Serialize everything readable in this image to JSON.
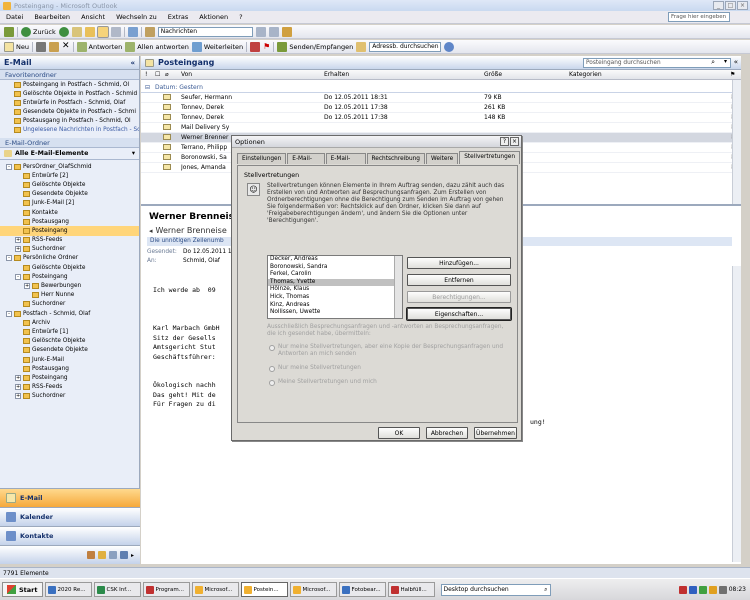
{
  "window": {
    "title": "Posteingang - Microsoft Outlook",
    "min": "_",
    "max": "□",
    "close": "×"
  },
  "menu": {
    "items": [
      "Datei",
      "Bearbeiten",
      "Ansicht",
      "Wechseln zu",
      "Extras",
      "Aktionen",
      "?"
    ],
    "help_placeholder": "Frage hier eingeben"
  },
  "toolbar1": {
    "back": "Zurück",
    "folder_combo": "Nachrichten"
  },
  "toolbar2": {
    "new": "Neu",
    "reply": "Antworten",
    "reply_all": "Allen antworten",
    "forward": "Weiterleiten",
    "send_receive": "Senden/Empfangen",
    "address_search": "Adressb. durchsuchen"
  },
  "nav": {
    "title": "E-Mail",
    "favorites_header": "Favoritenordner",
    "favorites": [
      "Posteingang in Postfach - Schmid, Ol",
      "Gelöschte Objekte in Postfach - Schmid",
      "Entwürfe in Postfach - Schmid, Olaf",
      "Gesendete Objekte in Postfach - Schmi",
      "Postausgang in Postfach - Schmid, Ol",
      "Ungelesene Nachrichten in Postfach - Sch"
    ],
    "mail_folders_header": "E-Mail-Ordner",
    "all_items": "Alle E-Mail-Elemente",
    "tree": [
      {
        "label": "PersOrdner_OlafSchmid",
        "indent": 0,
        "exp": "-"
      },
      {
        "label": "Entwürfe [2]",
        "indent": 1
      },
      {
        "label": "Gelöschte Objekte",
        "indent": 1
      },
      {
        "label": "Gesendete Objekte",
        "indent": 1
      },
      {
        "label": "Junk-E-Mail [2]",
        "indent": 1
      },
      {
        "label": "Kontakte",
        "indent": 1
      },
      {
        "label": "Postausgang",
        "indent": 1
      },
      {
        "label": "Posteingang",
        "indent": 1,
        "selected": true
      },
      {
        "label": "RSS-Feeds",
        "indent": 1,
        "exp": "+"
      },
      {
        "label": "Suchordner",
        "indent": 1,
        "exp": "+"
      },
      {
        "label": "Persönliche Ordner",
        "indent": 0,
        "exp": "-"
      },
      {
        "label": "Gelöschte Objekte",
        "indent": 1
      },
      {
        "label": "Posteingang",
        "indent": 1,
        "exp": "-"
      },
      {
        "label": "Bewerbungen",
        "indent": 2,
        "exp": "+"
      },
      {
        "label": "Herr Nunne",
        "indent": 2
      },
      {
        "label": "Suchordner",
        "indent": 1
      },
      {
        "label": "Postfach - Schmid, Olaf",
        "indent": 0,
        "exp": "-"
      },
      {
        "label": "Archiv",
        "indent": 1
      },
      {
        "label": "Entwürfe [1]",
        "indent": 1
      },
      {
        "label": "Gelöschte Objekte",
        "indent": 1
      },
      {
        "label": "Gesendete Objekte",
        "indent": 1
      },
      {
        "label": "Junk-E-Mail",
        "indent": 1
      },
      {
        "label": "Postausgang",
        "indent": 1
      },
      {
        "label": "Posteingang",
        "indent": 1,
        "exp": "+"
      },
      {
        "label": "RSS-Feeds",
        "indent": 1,
        "exp": "+"
      },
      {
        "label": "Suchordner",
        "indent": 1,
        "exp": "+"
      }
    ],
    "buttons": [
      "E-Mail",
      "Kalender",
      "Kontakte"
    ]
  },
  "list": {
    "title": "Posteingang",
    "search_placeholder": "Posteingang durchsuchen",
    "columns": {
      "from": "Von",
      "received": "Erhalten",
      "size": "Größe",
      "categories": "Kategorien"
    },
    "group": "Datum: Gestern",
    "rows": [
      {
        "from": "Seufer, Hermann",
        "date": "Do 12.05.2011 18:31",
        "size": "79 KB"
      },
      {
        "from": "Tonnev, Derek",
        "date": "Do 12.05.2011 17:38",
        "size": "261 KB"
      },
      {
        "from": "Tonnev, Derek",
        "date": "Do 12.05.2011 17:38",
        "size": "148 KB"
      },
      {
        "from": "Mail Delivery Sy",
        "date": "",
        "size": ""
      },
      {
        "from": "Werner Brenner",
        "date": "",
        "size": "",
        "selected": true
      },
      {
        "from": "Terrano, Philipp",
        "date": "",
        "size": ""
      },
      {
        "from": "Boronowski, Sa",
        "date": "",
        "size": ""
      },
      {
        "from": "Jones, Amanda",
        "date": "",
        "size": ""
      }
    ]
  },
  "reading": {
    "subject_short": "Werner Brenneise",
    "from_full": "Werner Brenneise",
    "info": "Die unnötigen Zeilenumb",
    "sent_label": "Gesendet:",
    "sent_value": "Do 12.05.2011 1",
    "to_label": "An:",
    "to_value": "Schmid, Olaf",
    "body": [
      "Ich werde ab  09",
      "",
      "",
      "",
      "Karl Marbach GmbH",
      "Sitz der Gesells",
      "Amtsgericht Stut",
      "Geschäftsführer:",
      "",
      "",
      "Ökologisch nachh",
      "Das geht! Mit de",
      "Für Fragen zu di"
    ],
    "body_tail": "ung!"
  },
  "dialog": {
    "title": "Optionen",
    "help": "?",
    "close": "×",
    "tabs": [
      "Einstellungen",
      "E-Mail-Setup",
      "E-Mail-Format",
      "Rechtschreibung",
      "Weitere",
      "Stellvertretungen"
    ],
    "group": "Stellvertretungen",
    "description": "Stellvertretungen können Elemente in Ihrem Auftrag senden, dazu zählt auch das Erstellen von und Antworten auf Besprechungsanfragen. Zum Erstellen von Ordnerberechtigungen ohne die Berechtigung zum Senden im Auftrag von gehen Sie folgendermaßen vor: Rechtsklick auf den Ordner, klicken Sie dann auf 'Freigabeberechtigungen ändern', und ändern Sie die Optionen unter 'Berechtigungen'.",
    "delegates": [
      "Decker, Andreas",
      "Boronowski, Sandra",
      "Ferkel, Carolin",
      "Thomas, Yvette",
      "Hölnze, Klaus",
      "Hick, Thomas",
      "Kinz, Andreas",
      "Nollissen, Uwette"
    ],
    "btn_add": "Hinzufügen...",
    "btn_remove": "Entfernen",
    "btn_perms": "Berechtigungen...",
    "btn_props": "Eigenschaften...",
    "deliver_label": "Ausschließlich Besprechungsanfragen und -antworten an Besprechungsanfragen, die ich gesendet habe, übermitteln:",
    "opt1": "Nur meine Stellvertretungen, aber eine Kopie der Besprechungsanfragen und Antworten an mich senden",
    "opt2": "Nur meine Stellvertretungen",
    "opt3": "Meine Stellvertretungen und mich",
    "ok": "OK",
    "cancel": "Abbrechen",
    "apply": "Übernehmen"
  },
  "status": {
    "text": "7791 Elemente"
  },
  "taskbar": {
    "start": "Start",
    "tasks": [
      "2020 Re...",
      "CSK Inf...",
      "Program...",
      "Microsof...",
      "Postein...",
      "Microsof...",
      "Fotobear...",
      "Halbfüll..."
    ],
    "active_index": 4,
    "search_placeholder": "Desktop durchsuchen",
    "clock": "08:23"
  }
}
